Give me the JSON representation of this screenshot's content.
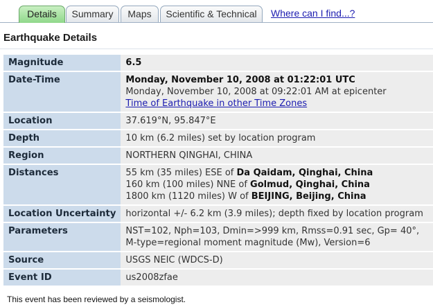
{
  "tabs": [
    {
      "label": "Details"
    },
    {
      "label": "Summary"
    },
    {
      "label": "Maps"
    },
    {
      "label": "Scientific & Technical"
    }
  ],
  "where_link": "Where can I find...?",
  "page_title": "Earthquake Details",
  "rows": {
    "magnitude": {
      "label": "Magnitude",
      "value": "6.5"
    },
    "datetime": {
      "label": "Date-Time",
      "utc": "Monday, November 10, 2008 at 01:22:01 UTC",
      "local": "Monday, November 10, 2008 at 09:22:01 AM at epicenter",
      "link": "Time of Earthquake in other Time Zones"
    },
    "location": {
      "label": "Location",
      "value": "37.619°N, 95.847°E"
    },
    "depth": {
      "label": "Depth",
      "value": "10 km (6.2 miles) set by location program"
    },
    "region": {
      "label": "Region",
      "value": "NORTHERN QINGHAI, CHINA"
    },
    "distances": {
      "label": "Distances",
      "lines": [
        {
          "prefix": "55 km (35 miles) ESE of ",
          "place": "Da Qaidam, Qinghai, China"
        },
        {
          "prefix": "160 km (100 miles) NNE of ",
          "place": "Golmud, Qinghai, China"
        },
        {
          "prefix": "1800 km (1120 miles) W of ",
          "place": "BEIJING, Beijing, China"
        }
      ]
    },
    "uncertainty": {
      "label": "Location Uncertainty",
      "value": "horizontal +/- 6.2 km (3.9 miles); depth fixed by location program"
    },
    "parameters": {
      "label": "Parameters",
      "lines": [
        "NST=102, Nph=103, Dmin=>999 km, Rmss=0.91 sec, Gp= 40°,",
        "M-type=regional moment magnitude (Mw), Version=6"
      ]
    },
    "source": {
      "label": "Source",
      "value": "USGS NEIC (WDCS-D)"
    },
    "event_id": {
      "label": "Event ID",
      "value": "us2008zfae"
    }
  },
  "footer": "This event has been reviewed by a seismologist."
}
